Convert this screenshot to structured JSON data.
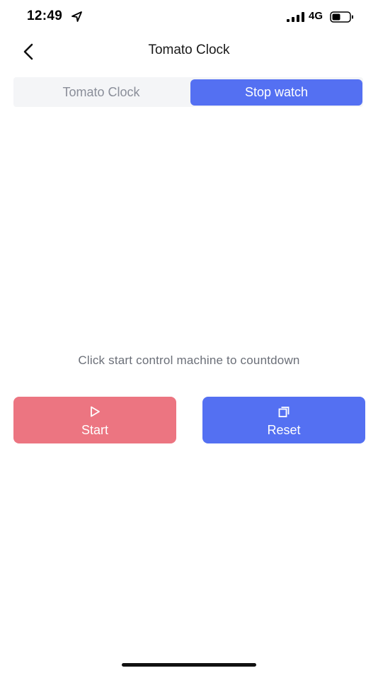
{
  "status_bar": {
    "time": "12:49",
    "network": "4G",
    "icons": [
      "location-arrow-icon",
      "signal-bars-icon",
      "battery-icon"
    ]
  },
  "nav": {
    "title": "Tomato Clock",
    "back_icon": "chevron-left-icon"
  },
  "tabs": [
    {
      "label": "Tomato Clock",
      "selected": false
    },
    {
      "label": "Stop watch",
      "selected": true
    }
  ],
  "main": {
    "hint": "Click start control machine to countdown"
  },
  "actions": {
    "start": {
      "label": "Start",
      "icon": "play-icon",
      "color": "#ec7581"
    },
    "reset": {
      "label": "Reset",
      "icon": "copy-icon",
      "color": "#5470f2"
    }
  },
  "colors": {
    "accent": "#5470f2",
    "start": "#ec7581",
    "hint_text": "#6b6f78"
  }
}
